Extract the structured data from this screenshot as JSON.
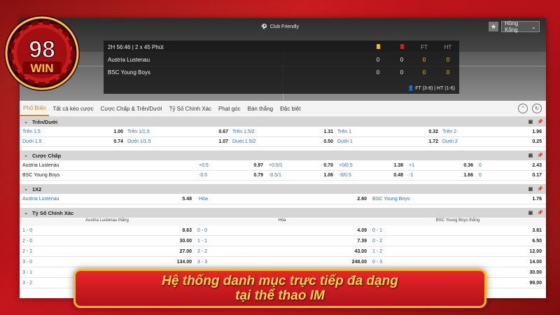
{
  "logo": {
    "number": "98",
    "word": "WIN"
  },
  "header": {
    "league": "Club Friendly",
    "region": "Hồng Kông",
    "match_info": "2H 56:46 | 2 x 45 Phút",
    "col_ft": "FT",
    "col_ht": "HT",
    "teams": [
      {
        "name": "Austria Lustenau",
        "yellow": "0",
        "red": "0",
        "ft": "0",
        "ht": "0"
      },
      {
        "name": "BSC Young Boys",
        "yellow": "0",
        "red": "0",
        "ft": "0",
        "ht": "0"
      }
    ],
    "footer": "FT (3-8)  |  HT (1-6)"
  },
  "tabs": [
    "Phổ Biến",
    "Tất cả kèo cược",
    "Cược Chấp & Trên/Dưới",
    "Tỷ Số Chính Xác",
    "Phạt góc",
    "Bàn thắng",
    "Đặc biệt"
  ],
  "sections": {
    "over_under": {
      "title": "Trên/Dưới",
      "rows": [
        [
          {
            "l": "Trên 1.5",
            "v": "1.00"
          },
          {
            "l": "Trên 1/1.5",
            "v": "0.67"
          },
          {
            "l": "Trên 1.5/2",
            "v": "1.31"
          },
          {
            "l": "Trên 1",
            "v": "0.32"
          },
          {
            "l": "Trên 2",
            "v": "1.96"
          }
        ],
        [
          {
            "l": "Dưới 1.5",
            "v": "0.74"
          },
          {
            "l": "Dưới 1/1.5",
            "v": "1.07"
          },
          {
            "l": "Dưới 1.5/2",
            "v": "0.50"
          },
          {
            "l": "Dưới 1",
            "v": "1.72"
          },
          {
            "l": "Dưới 2",
            "v": "0.25"
          }
        ]
      ]
    },
    "handicap": {
      "title": "Cược Chấp",
      "rows": [
        {
          "team": "Austria Lustenau",
          "cells": [
            {
              "l": "+0.5",
              "v": "0.97"
            },
            {
              "l": "+0.5/1",
              "v": "0.70"
            },
            {
              "l": "+0/0.5",
              "v": "1.38"
            },
            {
              "l": "+1",
              "v": "0.36"
            },
            {
              "l": "0",
              "v": "2.43"
            }
          ]
        },
        {
          "team": "BSC Young Boys",
          "cells": [
            {
              "l": "-0.5",
              "v": "0.79"
            },
            {
              "l": "-0.5/1",
              "v": "1.06"
            },
            {
              "l": "-0/0.5",
              "v": "0.48"
            },
            {
              "l": "-1",
              "v": "1.66"
            },
            {
              "l": "0",
              "v": "0.17"
            }
          ]
        }
      ]
    },
    "one_x_two": {
      "title": "1X2",
      "cells": [
        {
          "l": "Austria Lustenau",
          "v": "5.48"
        },
        {
          "l": "Hòa",
          "v": "2.60"
        },
        {
          "l": "BSC Young Boys",
          "v": "1.76"
        }
      ]
    },
    "correct_score": {
      "title": "Tỷ Số Chính Xác",
      "headers": [
        "Austria Lustenau thắng",
        "Hòa",
        "BSC Young Boys thắng"
      ],
      "rows": [
        [
          {
            "l": "1 - 0",
            "v": "8.63"
          },
          {
            "l": "0 - 0",
            "v": "4.09"
          },
          {
            "l": "0 - 1",
            "v": "3.81"
          }
        ],
        [
          {
            "l": "2 - 0",
            "v": "30.00"
          },
          {
            "l": "1 - 1",
            "v": "7.39"
          },
          {
            "l": "0 - 2",
            "v": "6.50"
          }
        ],
        [
          {
            "l": "2 - 1",
            "v": "27.00"
          },
          {
            "l": "2 - 2",
            "v": "43.00"
          },
          {
            "l": "1 - 2",
            "v": "12.00"
          }
        ],
        [
          {
            "l": "3 - 0",
            "v": "134.00"
          },
          {
            "l": "3 - 3",
            "v": "248.00"
          },
          {
            "l": "0 - 3",
            "v": "14.00"
          }
        ],
        [
          {
            "l": "3 - 1",
            "v": ""
          },
          {
            "l": "",
            "v": ""
          },
          {
            "l": "",
            "v": "30.00"
          }
        ],
        [
          {
            "l": "3 - 2",
            "v": ""
          },
          {
            "l": "",
            "v": ""
          },
          {
            "l": "",
            "v": "99.00"
          }
        ]
      ]
    }
  },
  "banner": {
    "line1": "Hệ thống danh mục trực tiếp đa dạng",
    "line2": "tại thể thao IM"
  }
}
